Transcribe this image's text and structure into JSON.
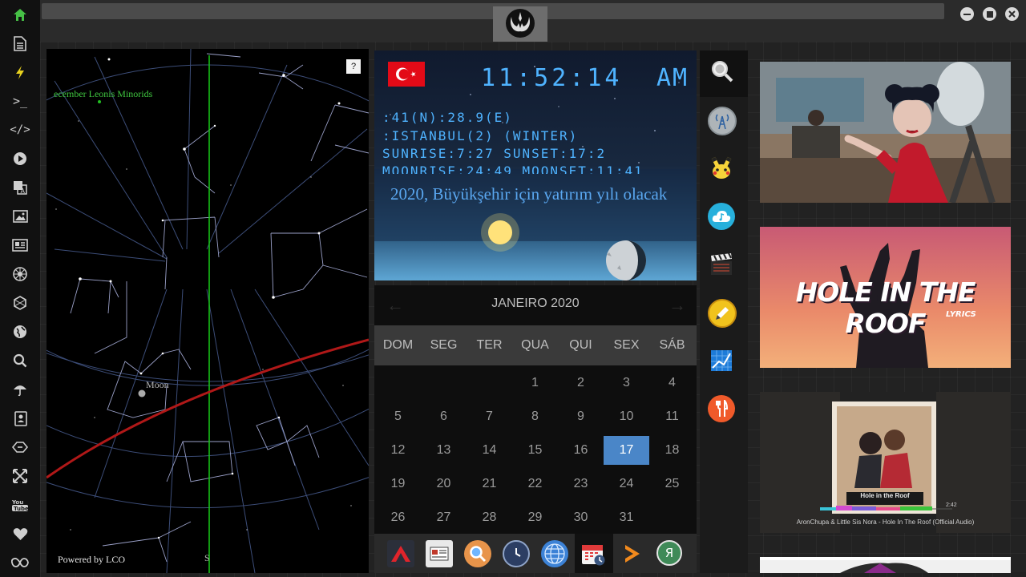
{
  "sidebar": {
    "icons": [
      "home-icon",
      "document-icon",
      "lightning-icon",
      "terminal-icon",
      "code-icon",
      "play-icon",
      "translate-icon",
      "image-icon",
      "newspaper-icon",
      "rebel-alliance-icon",
      "hexagon-icon",
      "globe-icon",
      "search-icon",
      "umbrella-icon",
      "contacts-icon",
      "tag-icon",
      "expand-icon",
      "youtube-icon",
      "heart-icon",
      "infinity-icon"
    ]
  },
  "sky": {
    "meteor_label": "ecember Leonis Minorids",
    "moon_label": "Moon",
    "help_label": "?",
    "powered_by": "Powered by LCO",
    "south_label": "S"
  },
  "clock": {
    "time": "11:52:14",
    "ampm": "AM",
    "coords": ":41(N):28.9(E)",
    "city": ":ISTANBUL(2) (WINTER)",
    "sun": "SUNRISE:7:27 SUNSET:17:2",
    "moon": "MOONRISE:24:49 MOONSET:11:41",
    "headline": "2020, Büyükşehir için yatırım yılı olacak"
  },
  "calendar": {
    "month_label": "JANEIRO 2020",
    "prev": "←",
    "next": "→",
    "weekdays": [
      "DOM",
      "SEG",
      "TER",
      "QUA",
      "QUI",
      "SEX",
      "SÁB"
    ],
    "weeks": [
      [
        "",
        "",
        "",
        "1",
        "2",
        "3",
        "4"
      ],
      [
        "5",
        "6",
        "7",
        "8",
        "9",
        "10",
        "11"
      ],
      [
        "12",
        "13",
        "14",
        "15",
        "16",
        "17",
        "18"
      ],
      [
        "19",
        "20",
        "21",
        "22",
        "23",
        "24",
        "25"
      ],
      [
        "26",
        "27",
        "28",
        "29",
        "30",
        "31",
        ""
      ]
    ],
    "today": "17",
    "accent": "#4a86c8"
  },
  "dock": {
    "icons": [
      "a-letter-icon",
      "newspaper-icon",
      "search-icon",
      "clock-icon",
      "globe-icon",
      "calendar-icon",
      "arrow-right-icon",
      "ya-letter-icon"
    ],
    "ya_glyph": "Я"
  },
  "apps": {
    "icons": [
      "search-icon",
      "radio-tower-icon",
      "pikachu-icon",
      "music-cloud-icon",
      "clapperboard-icon",
      "pencil-icon",
      "chart-icon",
      "cutlery-icon"
    ]
  },
  "videos": [
    {
      "caption": ""
    },
    {
      "title_text": "HOLE IN THE ROOF",
      "sub_text": "LYRICS"
    },
    {
      "caption": "AronChupa & Little Sis Nora - Hole In The Roof (Official Audio)",
      "timer": "2:42",
      "poster_title": "Hole in the Roof"
    },
    {
      "caption": ""
    }
  ]
}
